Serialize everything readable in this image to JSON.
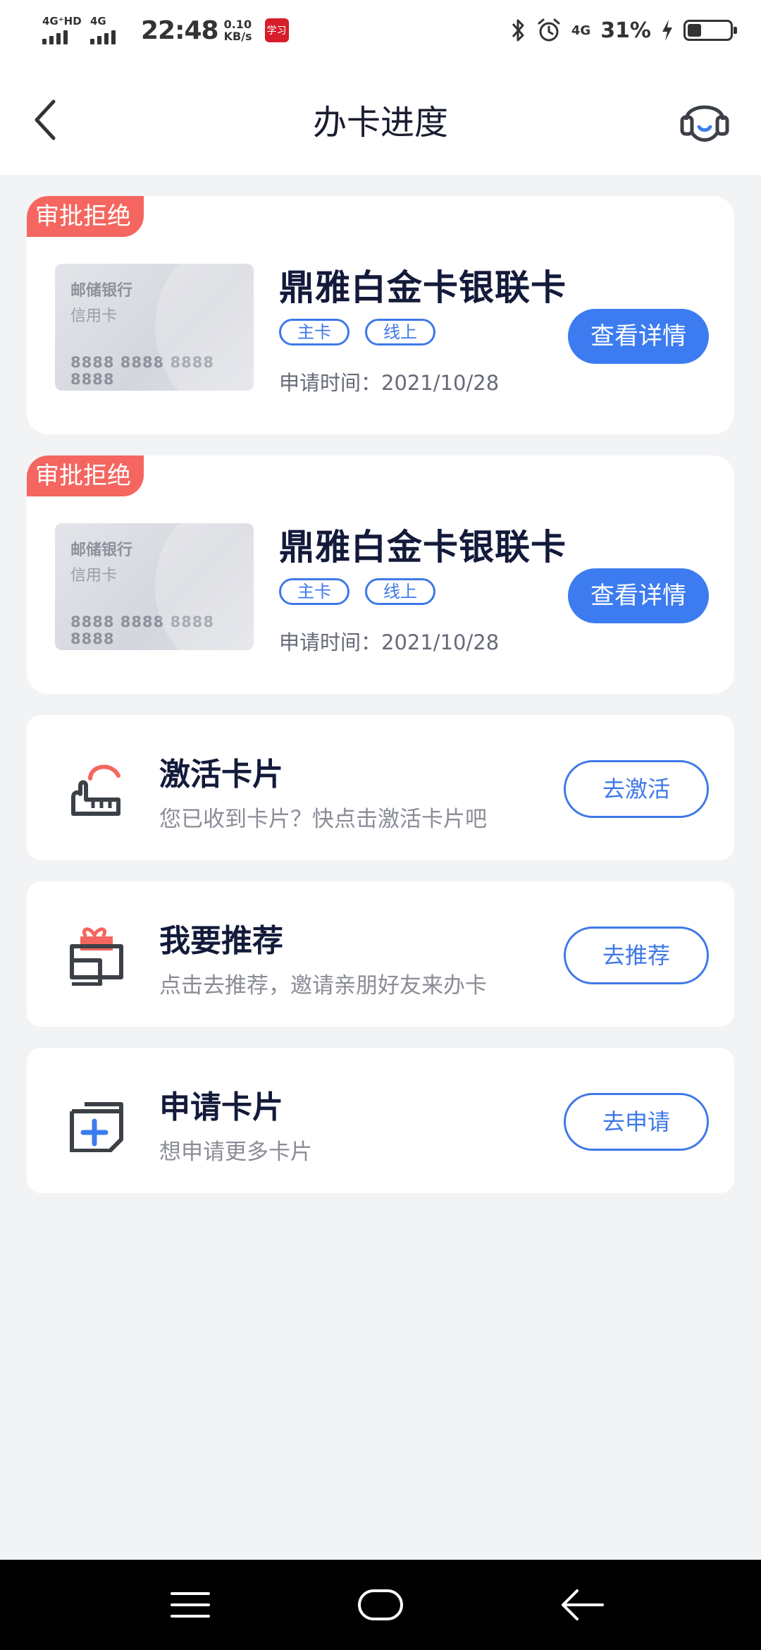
{
  "status_bar": {
    "sim1_label": "4G⁺HD",
    "sim2_label": "4G",
    "time": "22:48",
    "speed_value": "0.10",
    "speed_unit": "KB/s",
    "app_badge": "学习",
    "network_label": "4G",
    "battery_percent": "31%"
  },
  "nav": {
    "title": "办卡进度"
  },
  "applications": [
    {
      "status": "审批拒绝",
      "card_bank": "邮储银行",
      "card_type": "信用卡",
      "card_number": "8888 8888 8888 8888",
      "name": "鼎雅白金卡银联卡",
      "tags": [
        "主卡",
        "线上"
      ],
      "apply_time": "申请时间：2021/10/28",
      "button": "查看详情"
    },
    {
      "status": "审批拒绝",
      "card_bank": "邮储银行",
      "card_type": "信用卡",
      "card_number": "8888 8888 8888 8888",
      "name": "鼎雅白金卡银联卡",
      "tags": [
        "主卡",
        "线上"
      ],
      "apply_time": "申请时间：2021/10/28",
      "button": "查看详情"
    }
  ],
  "actions": [
    {
      "icon": "activate-card-icon",
      "title": "激活卡片",
      "subtitle": "您已收到卡片？快点击激活卡片吧",
      "button": "去激活"
    },
    {
      "icon": "gift-recommend-icon",
      "title": "我要推荐",
      "subtitle": "点击去推荐，邀请亲朋好友来办卡",
      "button": "去推荐"
    },
    {
      "icon": "apply-card-icon",
      "title": "申请卡片",
      "subtitle": "想申请更多卡片",
      "button": "去申请"
    }
  ],
  "colors": {
    "primary": "#3d7cf0",
    "reject": "#f4665f",
    "background": "#f2f3f5"
  }
}
